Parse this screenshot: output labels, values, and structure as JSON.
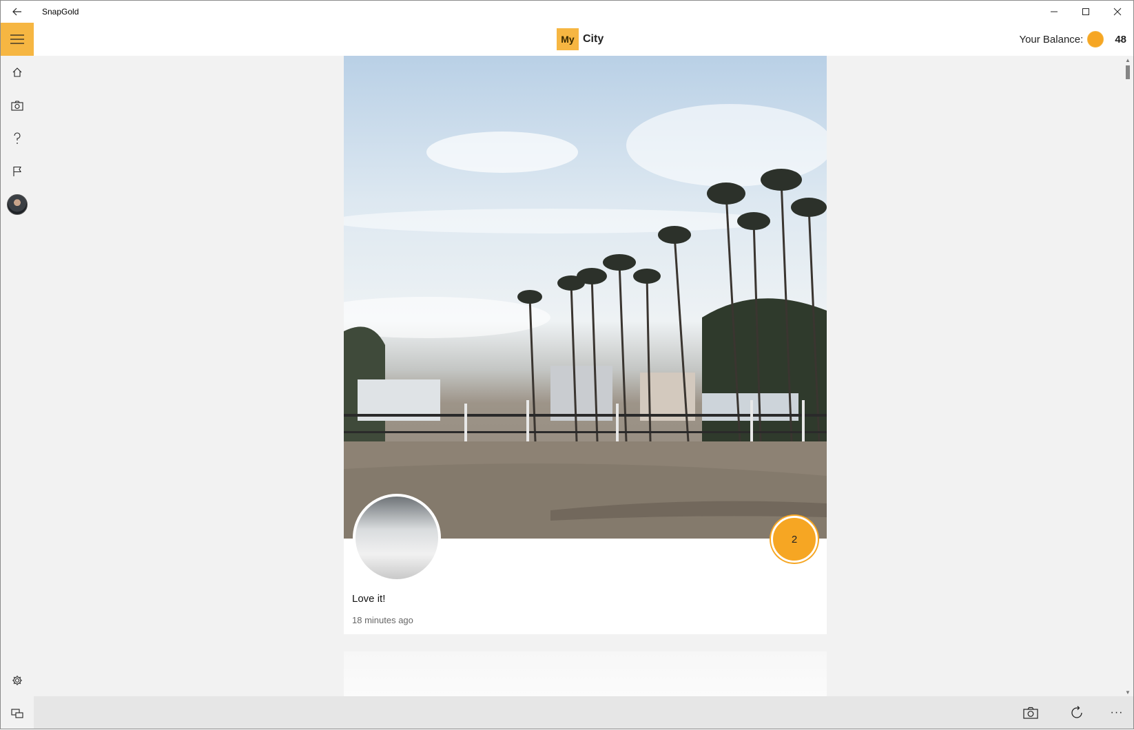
{
  "app": {
    "title": "SnapGold"
  },
  "header": {
    "logo_my": "My",
    "logo_city": "City",
    "balance_label": "Your Balance:",
    "balance_value": "48",
    "accent_color": "#f6b642"
  },
  "sidebar": {
    "items": [
      {
        "icon": "home-icon"
      },
      {
        "icon": "camera-icon"
      },
      {
        "icon": "help-icon"
      },
      {
        "icon": "flag-icon"
      },
      {
        "icon": "avatar"
      }
    ],
    "bottom_items": [
      {
        "icon": "gear-icon"
      },
      {
        "icon": "feedback-icon"
      }
    ]
  },
  "feed": {
    "posts": [
      {
        "caption": "Love it!",
        "timestamp": "18 minutes ago",
        "count": "2"
      }
    ]
  },
  "commandbar": {
    "items": [
      "camera-icon",
      "refresh-icon",
      "more-icon"
    ],
    "more_label": "···"
  }
}
